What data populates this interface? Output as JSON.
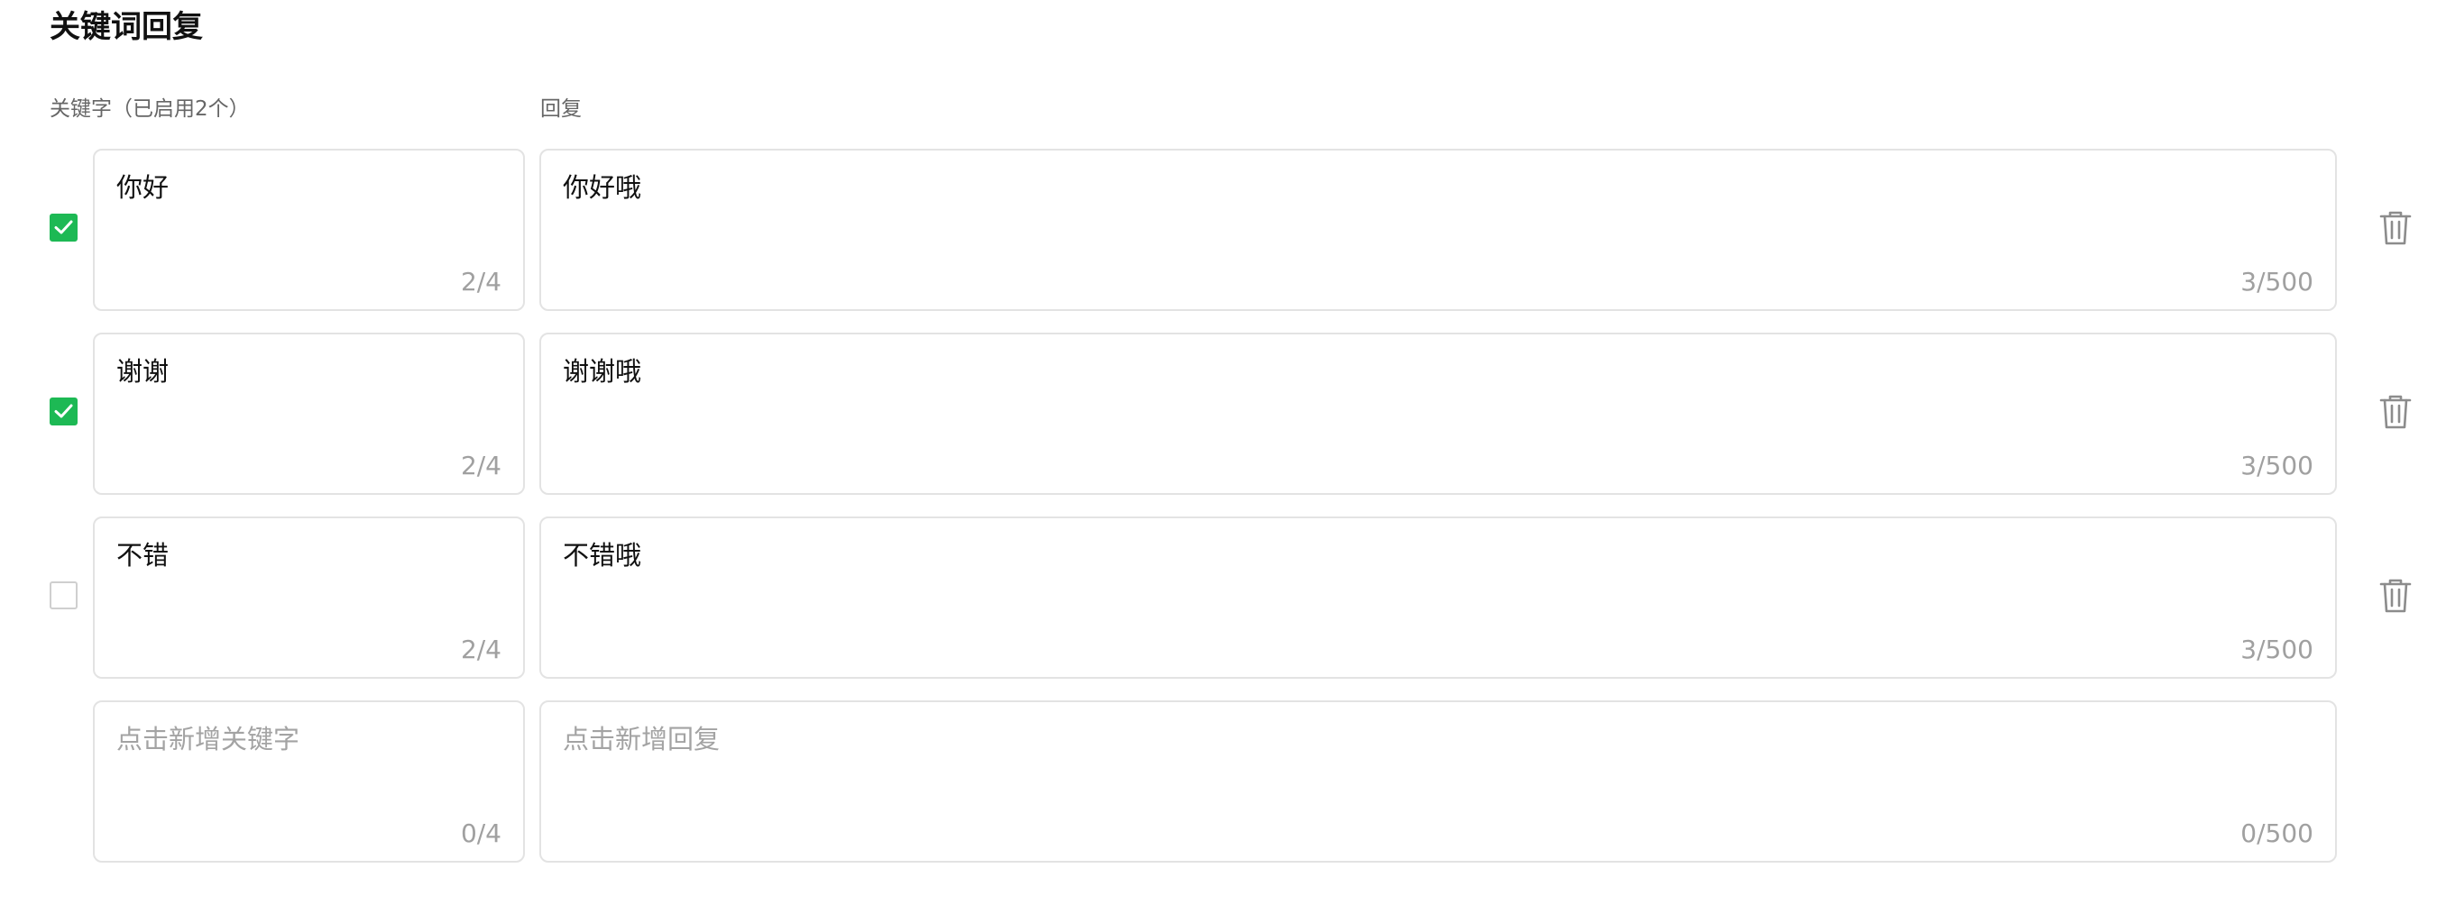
{
  "page": {
    "title": "关键词回复"
  },
  "columns": {
    "keyword_label": "关键字（已启用2个）",
    "reply_label": "回复"
  },
  "rows": [
    {
      "enabled": true,
      "keyword": "你好",
      "keyword_count": "2/4",
      "reply": "你好哦",
      "reply_count": "3/500"
    },
    {
      "enabled": true,
      "keyword": "谢谢",
      "keyword_count": "2/4",
      "reply": "谢谢哦",
      "reply_count": "3/500"
    },
    {
      "enabled": false,
      "keyword": "不错",
      "keyword_count": "2/4",
      "reply": "不错哦",
      "reply_count": "3/500"
    }
  ],
  "new_row": {
    "keyword_placeholder": "点击新增关键字",
    "keyword_count": "0/4",
    "reply_placeholder": "点击新增回复",
    "reply_count": "0/500"
  },
  "colors": {
    "accent": "#1db954",
    "border": "#e3e3e3",
    "muted_text": "#a0a0a0"
  },
  "icons": {
    "checkbox": "checkmark-icon",
    "delete": "trash-icon"
  }
}
